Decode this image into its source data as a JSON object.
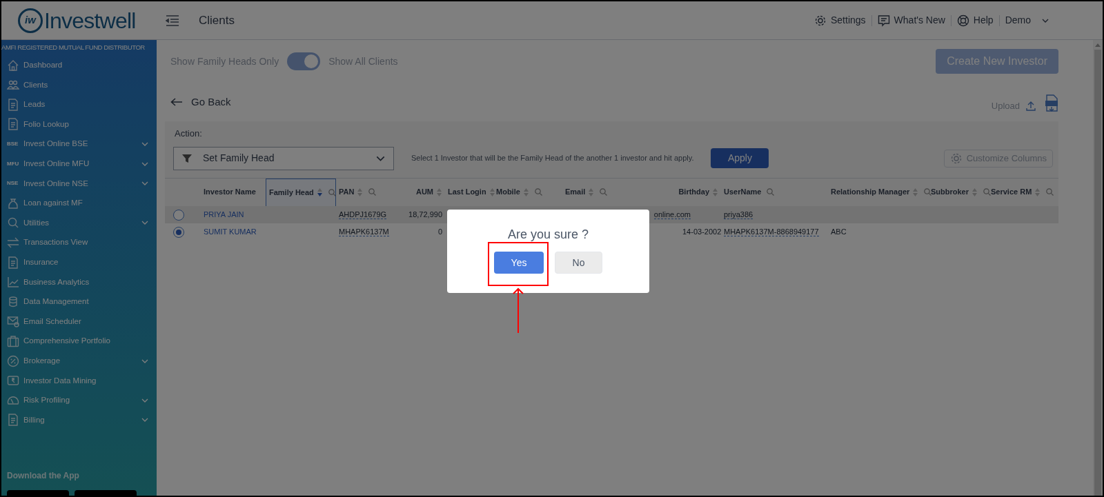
{
  "header": {
    "logo_mark": "iw",
    "logo_text": "Investwell",
    "page_title": "Clients",
    "links": [
      {
        "label": "Settings"
      },
      {
        "label": "What's New"
      },
      {
        "label": "Help"
      }
    ],
    "user": "Demo"
  },
  "sidebar": {
    "tagline": "AMFI REGISTERED MUTUAL FUND DISTRIBUTOR",
    "items": [
      {
        "label": "Dashboard",
        "expandable": false
      },
      {
        "label": "Clients",
        "expandable": false
      },
      {
        "label": "Leads",
        "expandable": false
      },
      {
        "label": "Folio Lookup",
        "expandable": false
      },
      {
        "label": "Invest Online BSE",
        "badge": "BSE",
        "expandable": true
      },
      {
        "label": "Invest Online MFU",
        "badge": "MFU",
        "expandable": true
      },
      {
        "label": "Invest Online NSE",
        "badge": "NSE",
        "expandable": true
      },
      {
        "label": "Loan against MF",
        "expandable": false
      },
      {
        "label": "Utilities",
        "expandable": true
      },
      {
        "label": "Transactions View",
        "expandable": false
      },
      {
        "label": "Insurance",
        "expandable": false
      },
      {
        "label": "Business Analytics",
        "expandable": false
      },
      {
        "label": "Data Management",
        "expandable": false
      },
      {
        "label": "Email Scheduler",
        "expandable": false
      },
      {
        "label": "Comprehensive Portfolio",
        "expandable": false
      },
      {
        "label": "Brokerage",
        "expandable": true
      },
      {
        "label": "Investor Data Mining",
        "expandable": false
      },
      {
        "label": "Risk Profiling",
        "expandable": true
      },
      {
        "label": "Billing",
        "expandable": true
      }
    ],
    "download_title": "Download the App"
  },
  "toolbar": {
    "toggle_left": "Show Family Heads Only",
    "toggle_on": true,
    "toggle_right": "Show All Clients",
    "create_button": "Create New Investor",
    "go_back": "Go Back",
    "upload": "Upload"
  },
  "action_panel": {
    "label": "Action:",
    "select_value": "Set Family Head",
    "hint": "Select 1 Investor that will be the Family Head of the another 1 investor and hit apply.",
    "apply": "Apply",
    "customize": "Customize Columns"
  },
  "table": {
    "columns": [
      {
        "label": "Investor Name",
        "sort": false,
        "search": false,
        "highlighted": false
      },
      {
        "label": "Family Head",
        "sort": true,
        "sort_desc": true,
        "search": true,
        "highlighted": true
      },
      {
        "label": "PAN",
        "sort": true,
        "sort_desc": false,
        "search": true,
        "highlighted": false
      },
      {
        "label": "AUM",
        "sort": true,
        "sort_desc": false,
        "search": false,
        "highlighted": false
      },
      {
        "label": "Last Login",
        "sort": true,
        "sort_desc": false,
        "search": false,
        "highlighted": false
      },
      {
        "label": "Mobile",
        "sort": true,
        "sort_desc": false,
        "search": true,
        "highlighted": false
      },
      {
        "label": "Email",
        "sort": true,
        "sort_desc": false,
        "search": true,
        "highlighted": false
      },
      {
        "label": "Birthday",
        "sort": true,
        "sort_desc": false,
        "search": false,
        "highlighted": false
      },
      {
        "label": "UserName",
        "sort": false,
        "search": true,
        "highlighted": false
      },
      {
        "label": "Relationship Manager",
        "sort": true,
        "sort_desc": false,
        "search": true,
        "highlighted": false
      },
      {
        "label": "Subbroker",
        "sort": true,
        "sort_desc": false,
        "search": true,
        "highlighted": false
      },
      {
        "label": "Service RM",
        "sort": true,
        "sort_desc": false,
        "search": true,
        "highlighted": false
      }
    ],
    "rows": [
      {
        "selected": false,
        "cells": [
          "PRIYA JAIN",
          "",
          "AHDPJ1679G",
          "18,72,990",
          "",
          "",
          "online.com",
          "",
          "priya386",
          "",
          "",
          ""
        ]
      },
      {
        "selected": true,
        "cells": [
          "SUMIT KUMAR",
          "",
          "MHAPK6137M",
          "0",
          "",
          "",
          "",
          "14-03-2002",
          "MHAPK6137M-8868949177",
          "ABC",
          "",
          ""
        ]
      }
    ]
  },
  "dialog": {
    "title": "Are you sure ?",
    "confirm": "Yes",
    "cancel": "No",
    "confirm_highlighted": true
  }
}
